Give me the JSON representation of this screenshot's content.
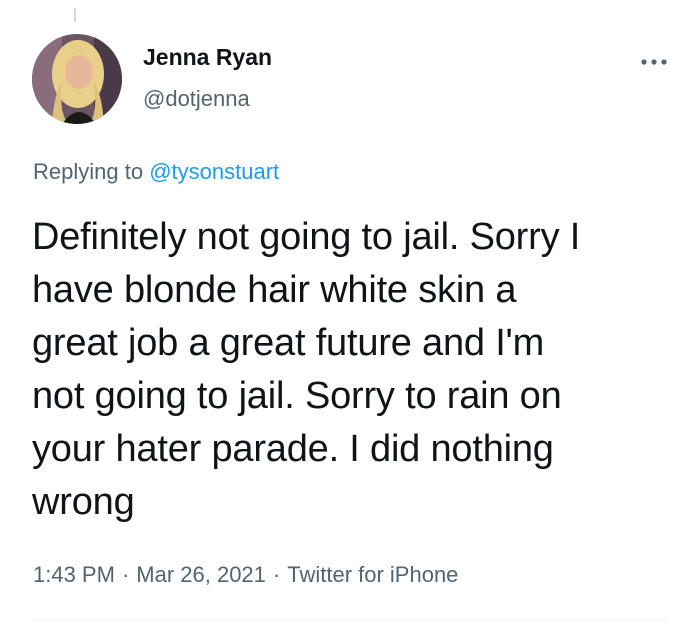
{
  "tweet": {
    "author": {
      "display_name": "Jenna Ryan",
      "handle": "@dotjenna"
    },
    "reply": {
      "prefix": "Replying to",
      "mention": "@tysonstuart"
    },
    "text_lines": [
      "Definitely not going to jail. Sorry I",
      "have blonde hair white skin a",
      "great job a great future and I'm",
      "not going to jail. Sorry to rain on",
      "your hater parade. I did nothing",
      "wrong"
    ],
    "meta": {
      "time": "1:43 PM",
      "separator": "·",
      "date": "Mar 26, 2021",
      "source": "Twitter for iPhone"
    },
    "icons": {
      "more": "more-options-icon",
      "avatar": "profile-avatar"
    },
    "colors": {
      "link": "#1d9bf0",
      "secondary_text": "#536471",
      "primary_text": "#0f1419"
    }
  }
}
